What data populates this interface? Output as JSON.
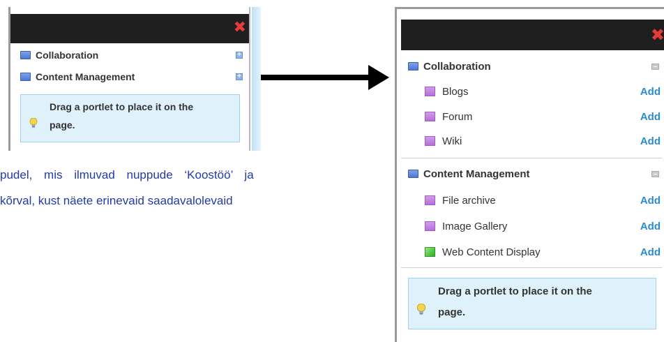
{
  "left_panel": {
    "categories": [
      {
        "label": "Collaboration"
      },
      {
        "label": "Content Management"
      }
    ],
    "hint": {
      "line1": "Drag a portlet to place it on the",
      "line2": "page."
    }
  },
  "body_text": {
    "line1": "pudel, mis ilmuvad nuppude ‘Koostöö’ ja",
    "line2": "kõrval, kust näete erinevaid saadavalolevaid"
  },
  "right_panel": {
    "collaboration": {
      "label": "Collaboration",
      "items": [
        {
          "label": "Blogs",
          "action": "Add"
        },
        {
          "label": "Forum",
          "action": "Add"
        },
        {
          "label": "Wiki",
          "action": "Add"
        }
      ]
    },
    "content_management": {
      "label": "Content Management",
      "items": [
        {
          "label": "File archive",
          "action": "Add"
        },
        {
          "label": "Image Gallery",
          "action": "Add"
        },
        {
          "label": "Web Content Display",
          "action": "Add"
        }
      ]
    },
    "hint": {
      "line1": "Drag a portlet to place it on the",
      "line2": "page."
    }
  },
  "icons": {
    "close": "close-x-icon",
    "category": "category-folder-icon",
    "expand": "plus-icon",
    "collapse": "minus-icon",
    "portlet": "portlet-icon",
    "web_content": "web-content-icon",
    "hint": "lightbulb-icon"
  },
  "colors": {
    "titlebar": "#1f1f1f",
    "close": "#e53b3b",
    "add_link": "#2a8bd0",
    "hint_bg": "#dff2fc",
    "body_text": "#233aa8"
  }
}
